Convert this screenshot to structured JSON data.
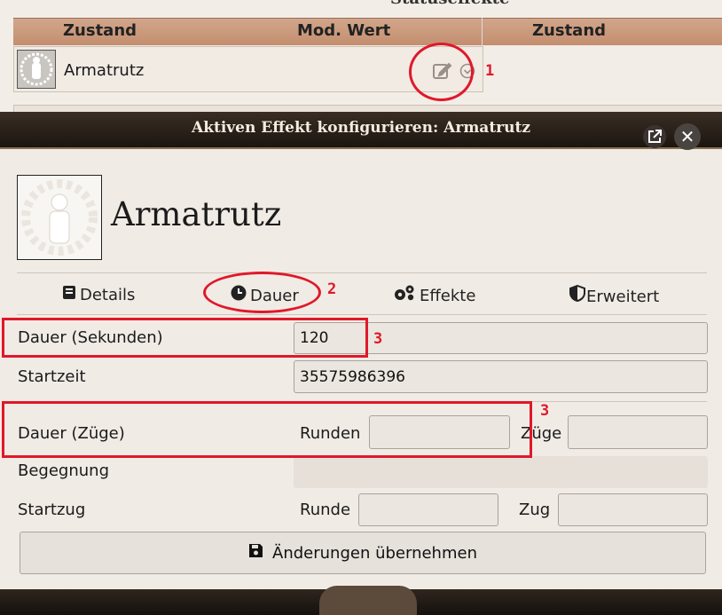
{
  "background_sheet": {
    "title_fragment": "Statuseffekte",
    "headers": [
      "Zustand",
      "Mod. Wert",
      "Zustand"
    ],
    "row": {
      "name": "Armatrutz"
    }
  },
  "dialog": {
    "title": "Aktiven Effekt konfigurieren: Armatrutz",
    "effect_name": "Armatrutz",
    "tabs": [
      {
        "label": "Details",
        "icon": "book-icon"
      },
      {
        "label": "Dauer",
        "icon": "clock-icon"
      },
      {
        "label": "Effekte",
        "icon": "gears-icon"
      },
      {
        "label": "Erweitert",
        "icon": "shield-icon"
      }
    ],
    "fields": {
      "duration_seconds": {
        "label": "Dauer (Sekunden)",
        "value": "120"
      },
      "start_time": {
        "label": "Startzeit",
        "value": "35575986396"
      },
      "duration_turns": {
        "label": "Dauer (Züge)",
        "rounds_label": "Runden",
        "rounds_value": "",
        "turns_label": "Züge",
        "turns_value": ""
      },
      "combat": {
        "label": "Begegnung",
        "value": ""
      },
      "start_turn": {
        "label": "Startzug",
        "round_label": "Runde",
        "round_value": "",
        "turn_label": "Zug",
        "turn_value": ""
      }
    },
    "submit_label": "Änderungen übernehmen"
  },
  "annotations": {
    "n1": "1",
    "n2": "2",
    "n3a": "3",
    "n3b": "3"
  },
  "colors": {
    "annotation": "#e0182a",
    "header": "#c99a7e",
    "frame": "#2a2119"
  }
}
